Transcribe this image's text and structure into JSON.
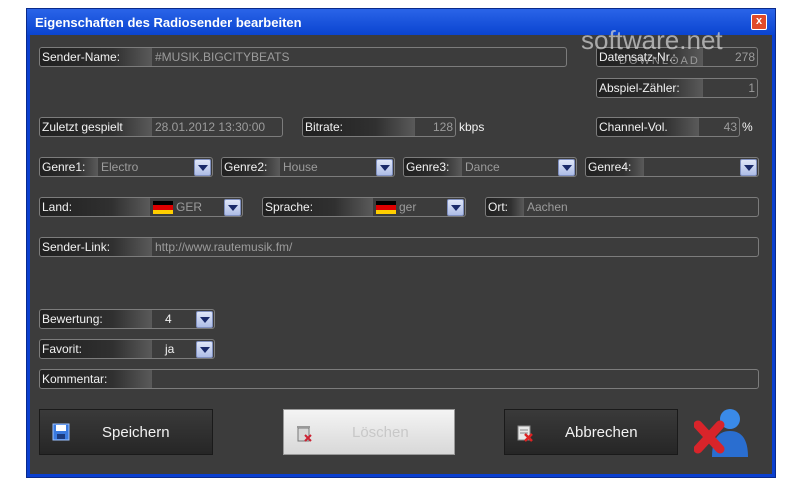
{
  "window": {
    "title": "Eigenschaften des Radiosender bearbeiten",
    "close": "x"
  },
  "station": {
    "name_label": "Sender-Name:",
    "name_value": "#MUSIK.BIGCITYBEATS"
  },
  "record": {
    "id_label": "Datensatz-Nr.:",
    "id_value": "278",
    "play_counter_label": "Abspiel-Zähler:",
    "play_counter_value": "1",
    "channel_vol_label": "Channel-Vol.",
    "channel_vol_value": "43",
    "channel_vol_unit": "%"
  },
  "last_played": {
    "label": "Zuletzt gespielt",
    "value": "28.01.2012 13:30:00"
  },
  "bitrate": {
    "label": "Bitrate:",
    "value": "128",
    "unit": "kbps"
  },
  "genres": [
    {
      "label": "Genre1:",
      "value": "Electro"
    },
    {
      "label": "Genre2:",
      "value": "House"
    },
    {
      "label": "Genre3:",
      "value": "Dance"
    },
    {
      "label": "Genre4:",
      "value": ""
    }
  ],
  "country": {
    "label": "Land:",
    "value": "GER"
  },
  "language": {
    "label": "Sprache:",
    "value": "ger"
  },
  "location": {
    "label": "Ort:",
    "value": "Aachen"
  },
  "link": {
    "label": "Sender-Link:",
    "value": "http://www.rautemusik.fm/"
  },
  "rating": {
    "label": "Bewertung:",
    "value": "4"
  },
  "favorite": {
    "label": "Favorit:",
    "value": "ja"
  },
  "comment": {
    "label": "Kommentar:",
    "value": ""
  },
  "buttons": {
    "save": "Speichern",
    "delete": "Löschen",
    "cancel": "Abbrechen"
  },
  "watermark": {
    "main": "software.net",
    "sub": "DOWNLOAD"
  },
  "colors": {
    "titlebar": "#0a44d0",
    "panel": "#3c3c3c",
    "dropdown": "#c7d2f0",
    "cancel_x": "#d8242a",
    "user_icon": "#2a7ad8"
  }
}
